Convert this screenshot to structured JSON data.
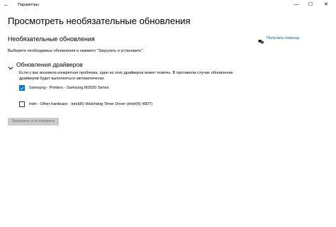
{
  "window": {
    "app_title": "Параметры",
    "back_glyph": "←",
    "minimize_glyph": "—",
    "maximize_glyph": "☐",
    "close_glyph": "✕"
  },
  "page": {
    "title": "Просмотреть необязательные обновления",
    "section_title": "Необязательные обновления",
    "help_link": "Получить помощь",
    "description": "Выберите необходимые обновления и нажмите \"Загрузить и установить\"."
  },
  "driver_group": {
    "title": "Обновления драйверов",
    "description": "Если у вас возникла конкретная проблема, один из этих драйверов может помочь. В противном случае обновление драйверов будет выполняться автоматически.",
    "items": [
      {
        "label": "Samsung - Printers - Samsung M2020 Series",
        "checked": true
      },
      {
        "label": "Intel - Other hardware - Intel(R) Watchdog Timer Driver (Intel(R) WDT)",
        "checked": false
      }
    ]
  },
  "actions": {
    "install_label": "Загрузить и установить"
  },
  "colors": {
    "accent": "#0078d7",
    "link": "#0063b1",
    "button_disabled_bg": "#cccccc",
    "button_disabled_text": "#6d6d6d"
  },
  "icons": {
    "back": "back-arrow-icon",
    "help": "chat-help-icon",
    "chevron": "chevron-down-icon",
    "check": "checkmark-icon"
  }
}
